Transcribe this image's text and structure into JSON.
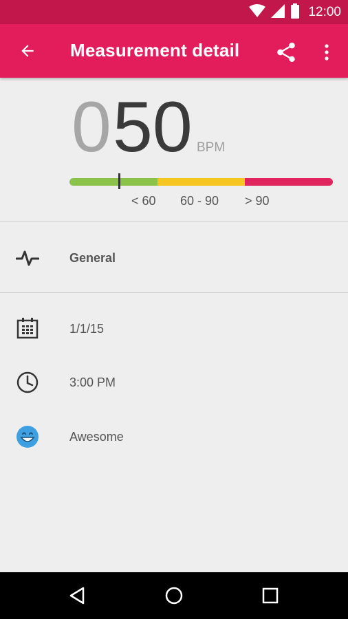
{
  "status_bar": {
    "time": "12:00",
    "icons": [
      "wifi-icon",
      "cell-signal-icon",
      "battery-icon"
    ]
  },
  "app_bar": {
    "title": "Measurement detail",
    "color": "#e31c5b",
    "back_icon": "arrow-back-icon",
    "share_icon": "share-icon",
    "menu_icon": "more-vert-icon"
  },
  "measurement": {
    "value_lead": "0",
    "value_main": "50",
    "unit": "BPM",
    "scale_ranges": [
      "< 60",
      "60 - 90",
      "> 90"
    ],
    "scale_colors": [
      "#8bc34a",
      "#f4c61f",
      "#e0245e"
    ]
  },
  "details": {
    "activity": "General",
    "date": "1/1/15",
    "time": "3:00 PM",
    "mood": "Awesome"
  },
  "nav_bar": {
    "icons": [
      "back-triangle-icon",
      "home-circle-icon",
      "recents-square-icon"
    ]
  }
}
